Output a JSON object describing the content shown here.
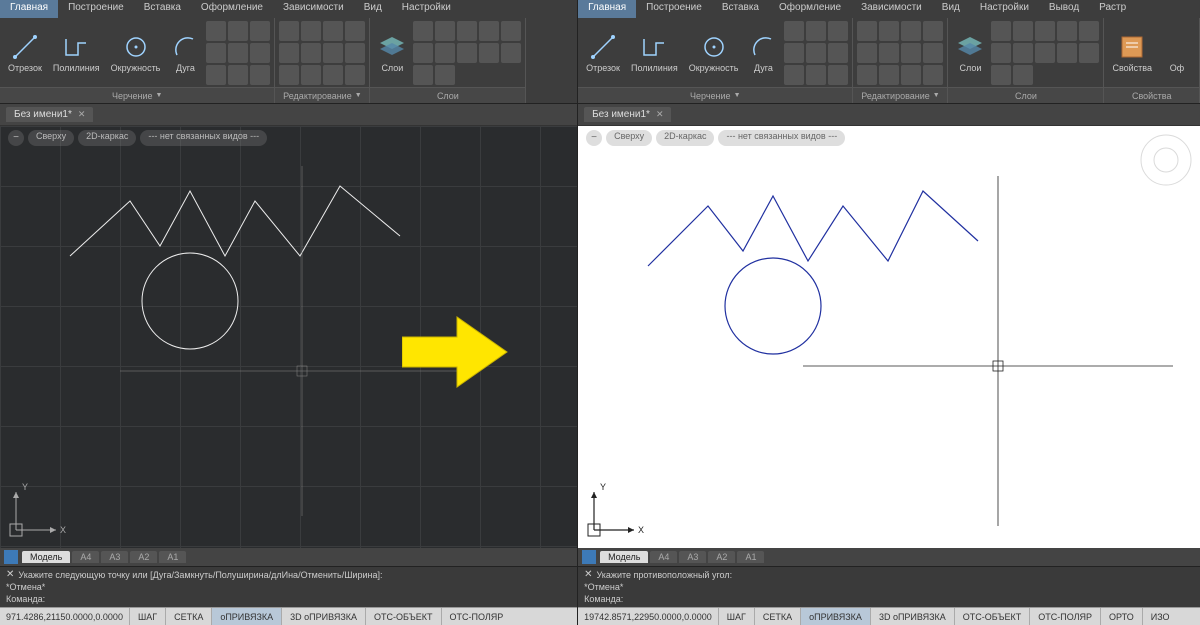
{
  "menus": [
    "Главная",
    "Построение",
    "Вставка",
    "Оформление",
    "Зависимости",
    "Вид",
    "Настройки",
    "Вывод",
    "Растр"
  ],
  "menus_left_visible": 7,
  "active_menu": "Главная",
  "panels": {
    "draw": {
      "label": "Черчение",
      "tools": [
        "Отрезок",
        "Полилиния",
        "Окружность",
        "Дуга"
      ]
    },
    "edit": {
      "label": "Редактирование"
    },
    "layers": {
      "label": "Слои",
      "btn": "Слои"
    },
    "props": {
      "label": "Свойства",
      "btn": "Свойства",
      "btn2": "Оф"
    }
  },
  "tab_name": "Без имени1*",
  "viewpills": [
    "Сверху",
    "2D-каркас",
    "--- нет связанных видов ---"
  ],
  "vtabs": [
    "Модель",
    "A4",
    "A3",
    "A2",
    "A1"
  ],
  "cmd_left": {
    "l1": "Укажите следующую точку или [Дуга/Замкнуть/Полуширина/длИна/Отменить/Ширина]:",
    "l2": "*Отмена*",
    "l3": "Команда:"
  },
  "cmd_right": {
    "l1": "Укажите противоположный угол:",
    "l2": "*Отмена*",
    "l3": "Команда:"
  },
  "status_left": {
    "coord": "971.4286,21150.0000,0.0000",
    "btns": [
      "ШАГ",
      "СЕТКА",
      "оПРИВЯЗКА",
      "3D оПРИВЯЗКА",
      "ОТС-ОБЪЕКТ",
      "ОТС-ПОЛЯР"
    ],
    "on": [
      2
    ]
  },
  "status_right": {
    "coord": "19742.8571,22950.0000,0.0000",
    "btns": [
      "ШАГ",
      "СЕТКА",
      "оПРИВЯЗКА",
      "3D оПРИВЯЗКА",
      "ОТС-ОБЪЕКТ",
      "ОТС-ПОЛЯР",
      "ОРТО",
      "ИЗО"
    ],
    "on": [
      2
    ]
  },
  "axes": {
    "x": "X",
    "y": "Y"
  }
}
